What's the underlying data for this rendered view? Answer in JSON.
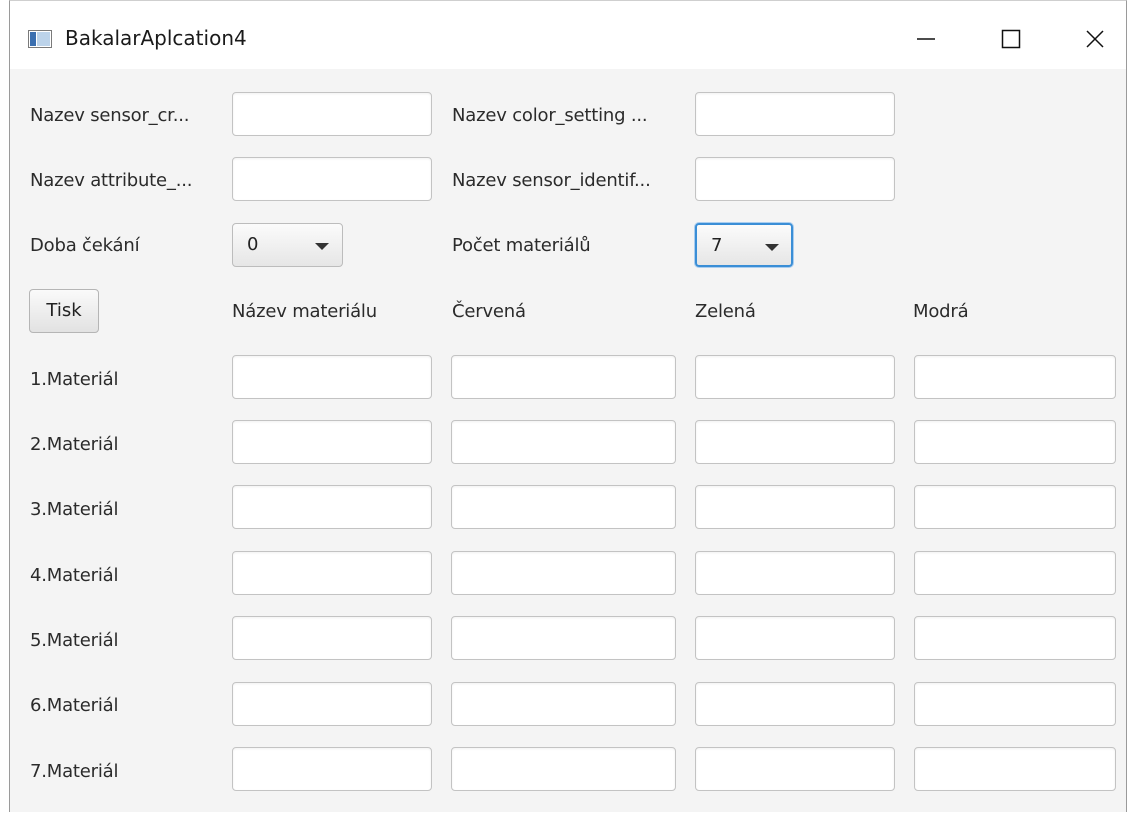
{
  "window": {
    "title": "BakalarAplcation4"
  },
  "settings": {
    "sensor_cr_label": "Nazev sensor_cr...",
    "sensor_cr_value": "",
    "color_setting_label": "Nazev color_setting ...",
    "color_setting_value": "",
    "attribute_label": "Nazev attribute_...",
    "attribute_value": "",
    "sensor_identif_label": "Nazev sensor_identif...",
    "sensor_identif_value": "",
    "wait_label": "Doba čekání",
    "wait_value": "0",
    "material_count_label": "Počet materiálů",
    "material_count_value": "7"
  },
  "toolbar": {
    "print_label": "Tisk"
  },
  "table": {
    "headers": [
      "Název materiálu",
      "Červená",
      "Zelená",
      "Modrá"
    ],
    "rows": [
      {
        "label": "1.Materiál",
        "name": "",
        "red": "",
        "green": "",
        "blue": ""
      },
      {
        "label": "2.Materiál",
        "name": "",
        "red": "",
        "green": "",
        "blue": ""
      },
      {
        "label": "3.Materiál",
        "name": "",
        "red": "",
        "green": "",
        "blue": ""
      },
      {
        "label": "4.Materiál",
        "name": "",
        "red": "",
        "green": "",
        "blue": ""
      },
      {
        "label": "5.Materiál",
        "name": "",
        "red": "",
        "green": "",
        "blue": ""
      },
      {
        "label": "6.Materiál",
        "name": "",
        "red": "",
        "green": "",
        "blue": ""
      },
      {
        "label": "7.Materiál",
        "name": "",
        "red": "",
        "green": "",
        "blue": ""
      }
    ]
  },
  "icons": {
    "app": "java-app-icon",
    "minimize": "minimize-icon",
    "maximize": "maximize-icon",
    "close": "close-icon",
    "dropdown": "chevron-down-icon"
  },
  "colors": {
    "focus": "#3a8ed6",
    "background": "#f4f4f4"
  }
}
